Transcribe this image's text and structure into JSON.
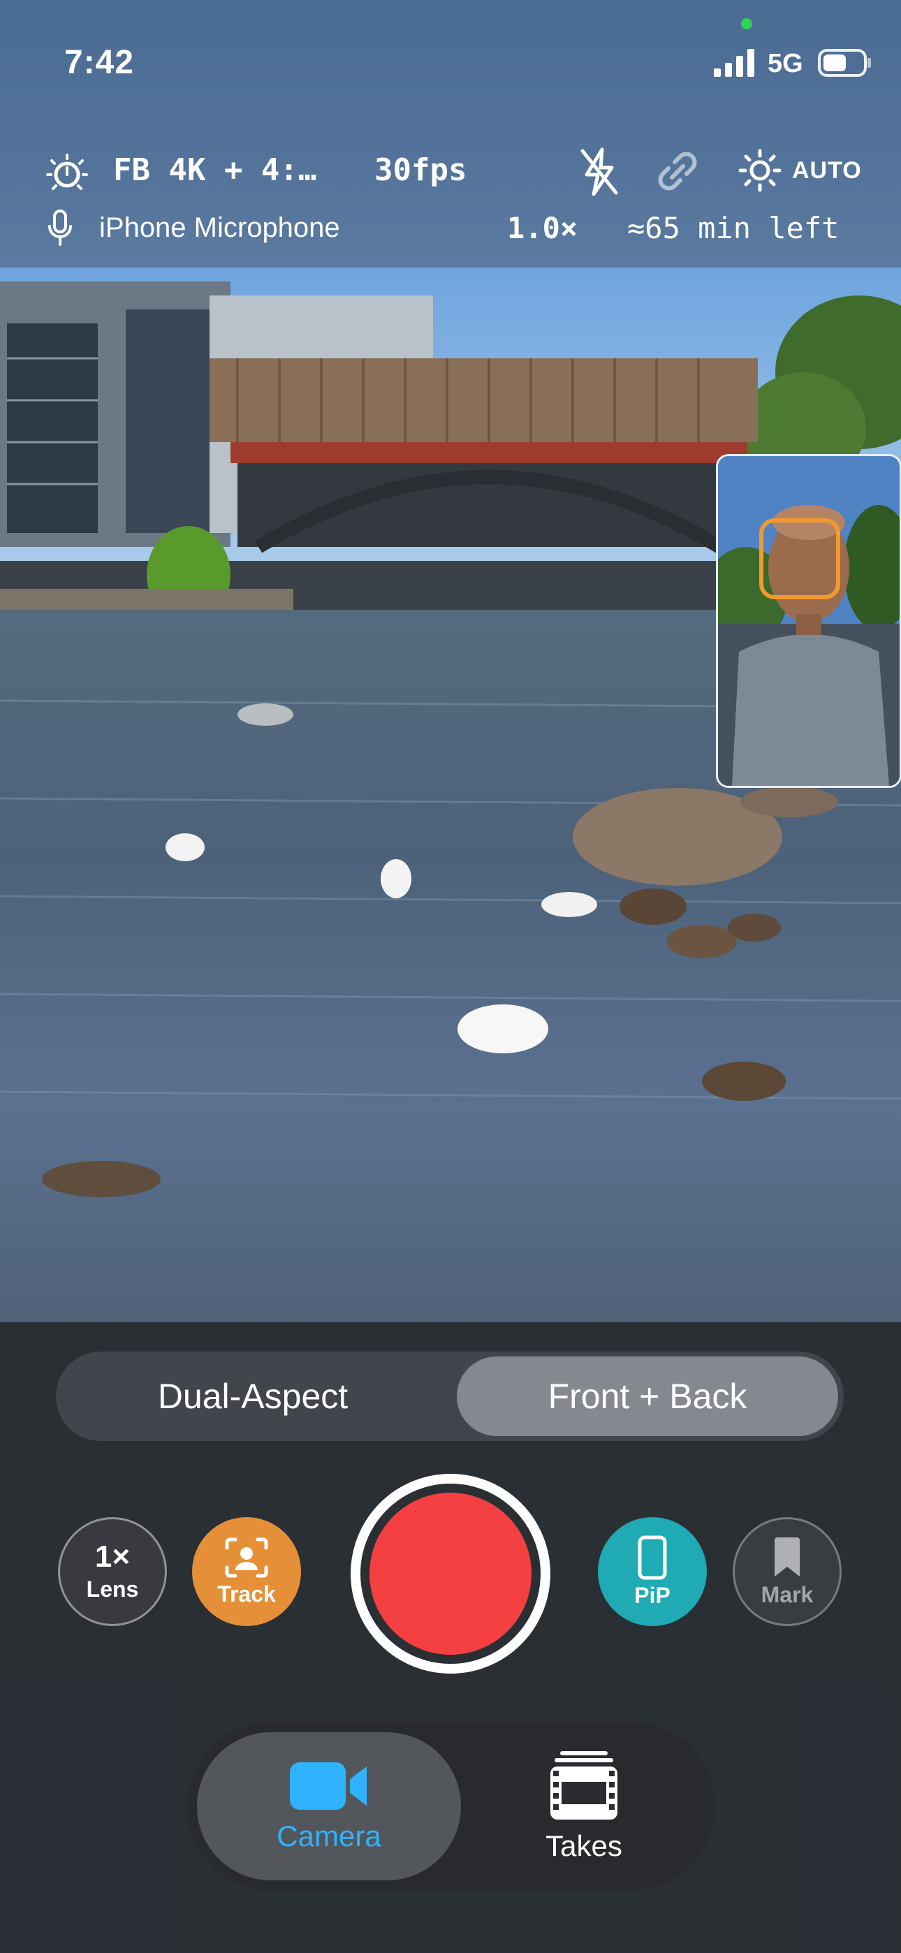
{
  "status_bar": {
    "time": "7:42",
    "network": "5G",
    "signal_bars": 4,
    "battery_level": 0.6
  },
  "recording_info": {
    "format": "FB 4K + 4:…",
    "fps": "30fps",
    "flash_icon": "flash-off-icon",
    "link_icon": "link-icon",
    "exposure_icon": "sun-icon",
    "exposure_mode": "AUTO",
    "microphone": "iPhone Microphone",
    "zoom": "1.0×",
    "time_left": "≈65 min left"
  },
  "mode_selector": {
    "options": [
      "Dual-Aspect",
      "Front + Back"
    ],
    "selected": "Front + Back"
  },
  "controls": {
    "lens_value": "1×",
    "lens_label": "Lens",
    "track_label": "Track",
    "pip_label": "PiP",
    "mark_label": "Mark"
  },
  "tabs": {
    "camera_label": "Camera",
    "takes_label": "Takes",
    "selected": "Camera"
  },
  "colors": {
    "record": "#f44040",
    "track": "#e59038",
    "pip": "#1faab4",
    "accent": "#2fb2ff",
    "face_box": "#f29a2e"
  }
}
